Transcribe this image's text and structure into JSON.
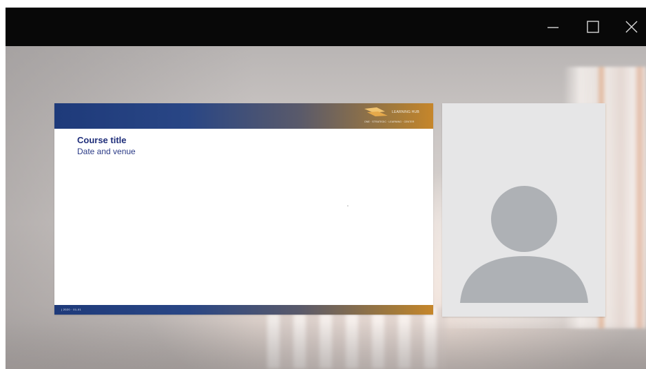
{
  "window": {
    "controls": {
      "minimize_icon": "minimize-icon",
      "maximize_icon": "maximize-icon",
      "close_icon": "close-icon"
    }
  },
  "slide": {
    "title": "Course title",
    "subtitle": "Date and venue",
    "logo_line_1": "LEARNING HUB",
    "logo_line_2": "ONE · STRATEGIC · LEARNING · CENTER",
    "footer_text": "| 2020 · 01-01",
    "colors": {
      "title": "#1f2e7a",
      "band_start": "#1e3a7a",
      "band_end": "#c6862a"
    }
  },
  "participant": {
    "avatar_icon": "person-placeholder-icon",
    "tile_color": "#e6e6e7",
    "avatar_color": "#aeb1b5"
  }
}
